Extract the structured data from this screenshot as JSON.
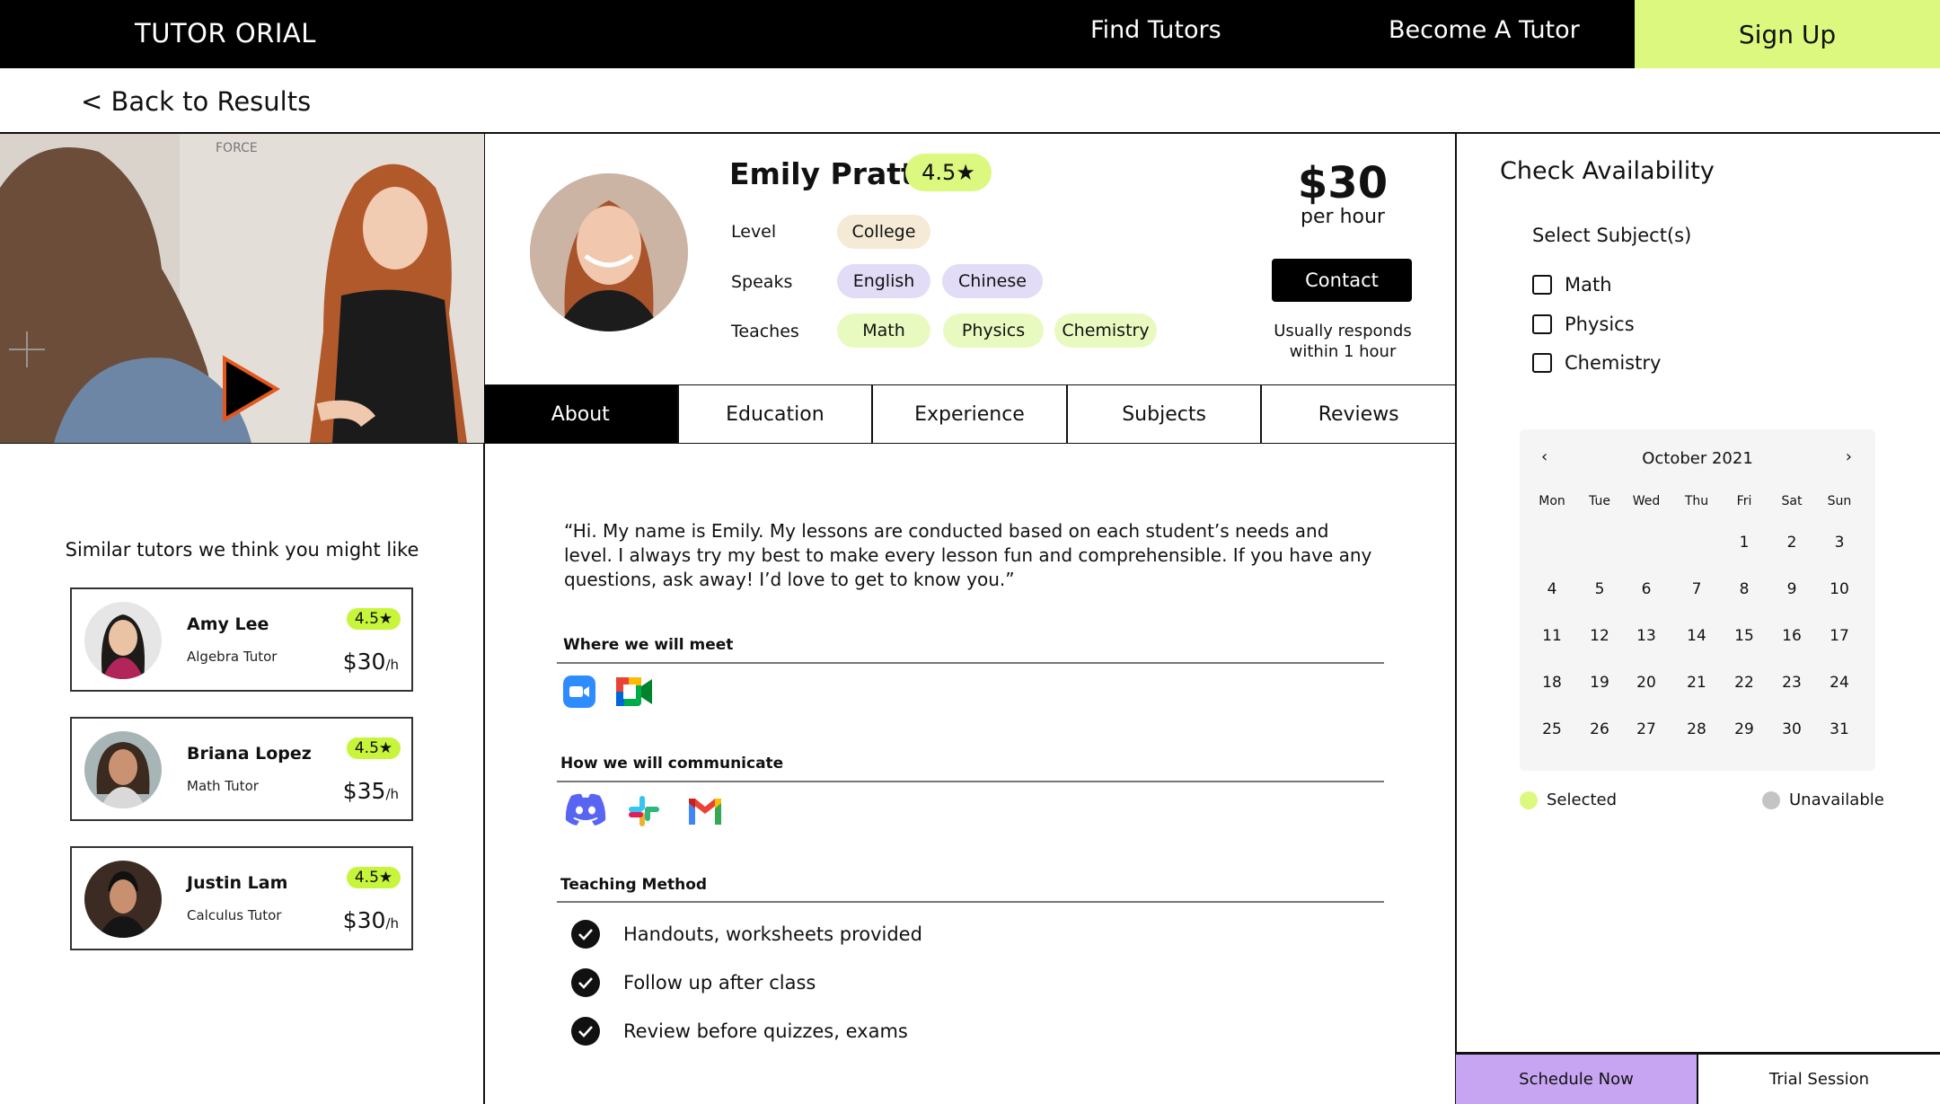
{
  "nav": {
    "logo": "TUTOR ORIAL",
    "find_tutors": "Find Tutors",
    "become_tutor": "Become A Tutor",
    "sign_up": "Sign Up"
  },
  "back_link": "< Back to Results",
  "profile": {
    "name": "Emily Pratt",
    "rating": "4.5★",
    "level_label": "Level",
    "level": "College",
    "speaks_label": "Speaks",
    "languages": [
      "English",
      "Chinese"
    ],
    "teaches_label": "Teaches",
    "subjects": [
      "Math",
      "Physics",
      "Chemistry"
    ],
    "price": "$30",
    "price_unit": "per hour",
    "contact_label": "Contact",
    "responds_line1": "Usually responds",
    "responds_line2": "within 1 hour"
  },
  "tabs": [
    "About",
    "Education",
    "Experience",
    "Subjects",
    "Reviews"
  ],
  "about": {
    "bio": "“Hi. My name is Emily. My lessons are conducted based on each student’s needs and level. I always try my best to make every lesson fun and comprehensible. If you have any questions, ask away! I’d love to get to know you.”",
    "meet_title": "Where we will meet",
    "meet_icons": [
      "zoom-icon",
      "google-meet-icon"
    ],
    "communicate_title": "How we will communicate",
    "communicate_icons": [
      "discord-icon",
      "slack-icon",
      "gmail-icon"
    ],
    "method_title": "Teaching Method",
    "methods": [
      "Handouts, worksheets provided",
      "Follow up after class",
      "Review before quizzes, exams"
    ]
  },
  "similar": {
    "title": "Similar tutors we think you might like",
    "tutors": [
      {
        "name": "Amy Lee",
        "role": "Algebra Tutor",
        "rating": "4.5★",
        "price": "$30",
        "unit": "/h"
      },
      {
        "name": "Briana Lopez",
        "role": "Math Tutor",
        "rating": "4.5★",
        "price": "$35",
        "unit": "/h"
      },
      {
        "name": "Justin Lam",
        "role": "Calculus Tutor",
        "rating": "4.5★",
        "price": "$30",
        "unit": "/h"
      }
    ]
  },
  "availability": {
    "title": "Check Availability",
    "select_subjects": "Select Subject(s)",
    "subjects": [
      "Math",
      "Physics",
      "Chemistry"
    ],
    "calendar": {
      "month": "October 2021",
      "prev": "‹",
      "next": "›",
      "weekdays": [
        "Mon",
        "Tue",
        "Wed",
        "Thu",
        "Fri",
        "Sat",
        "Sun"
      ],
      "first_weekday_index": 4,
      "days_in_month": 31
    },
    "legend_selected": "Selected",
    "legend_unavailable": "Unavailable",
    "colors": {
      "selected": "#dcf87e",
      "unavailable": "#c4c4c4"
    },
    "schedule_now": "Schedule Now",
    "trial_session": "Trial Session"
  },
  "colors": {
    "accent": "#dcf87e",
    "schedule": "#c7a5f2",
    "black": "#000000"
  }
}
